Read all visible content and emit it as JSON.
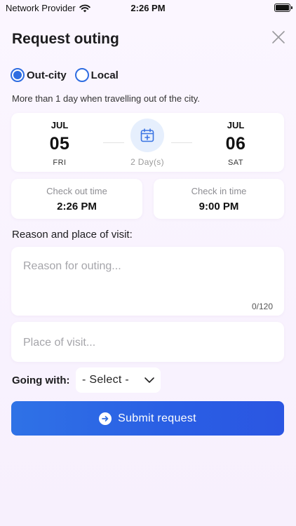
{
  "status_bar": {
    "carrier": "Network Provider",
    "time": "2:26 PM"
  },
  "header": {
    "title": "Request outing"
  },
  "trip_type": {
    "options": [
      {
        "label": "Out-city",
        "selected": true
      },
      {
        "label": "Local",
        "selected": false
      }
    ],
    "hint": "More than 1 day when travelling out of the city."
  },
  "dates": {
    "start": {
      "month": "JUL",
      "day": "05",
      "weekday": "FRI"
    },
    "end": {
      "month": "JUL",
      "day": "06",
      "weekday": "SAT"
    },
    "duration": "2 Day(s)"
  },
  "times": {
    "check_out": {
      "label": "Check out time",
      "value": "2:26 PM"
    },
    "check_in": {
      "label": "Check in time",
      "value": "9:00 PM"
    }
  },
  "reason_section": {
    "label": "Reason and place of visit:",
    "reason_placeholder": "Reason for outing...",
    "reason_counter": "0/120",
    "place_placeholder": "Place of visit..."
  },
  "going_with": {
    "label": "Going with:",
    "selected": "- Select -"
  },
  "submit": {
    "label": "Submit request"
  },
  "colors": {
    "accent": "#2f6de1",
    "button_gradient_start": "#2f72e6",
    "button_gradient_end": "#2b56e2",
    "background": "#fbf6ff"
  }
}
